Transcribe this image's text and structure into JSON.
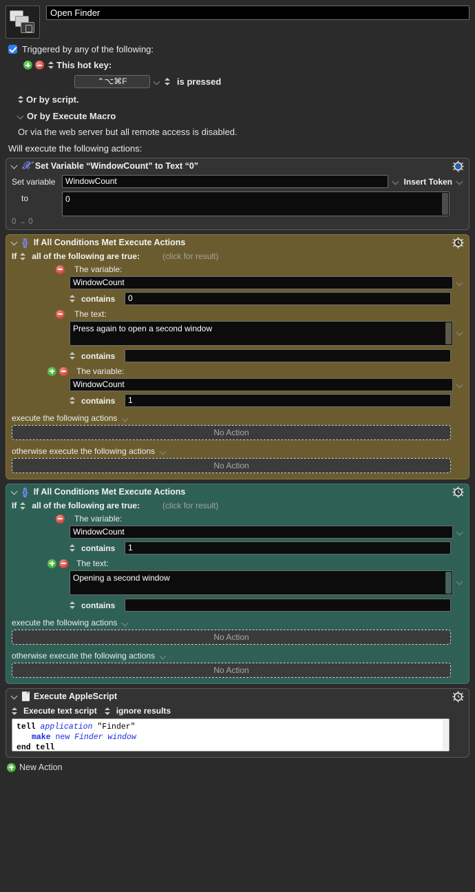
{
  "macro": {
    "icon_name": "stacked-windows-icon",
    "title": "Open Finder"
  },
  "trigger": {
    "checkbox_label": "Triggered by any of the following:",
    "hotkey_label": "This hot key:",
    "hotkey_value": "⌃⌥⌘F",
    "hotkey_condition": "is pressed",
    "or_by_script": "Or by script.",
    "or_by_execute_macro": "Or by Execute Macro",
    "web_server_note": "Or via the web server but all remote access is disabled.",
    "will_execute": "Will execute the following actions:"
  },
  "actions": [
    {
      "type": "set-variable",
      "title": "Set Variable “WindowCount” to Text “0”",
      "gear_icon": "gear-blue-icon",
      "set_variable_label": "Set variable",
      "variable_name": "WindowCount",
      "insert_token_label": "Insert Token",
      "to_label": "to",
      "to_value": "0",
      "result_line": "0 → 0",
      "color": "#333333"
    },
    {
      "type": "if-all-conditions",
      "title": "If All Conditions Met Execute Actions",
      "gear_icon": "gear-clock-icon",
      "color": "#6b5c2f",
      "if_label": "If",
      "condition_mode": "all of the following are true:",
      "click_for_result": "(click for result)",
      "conditions": [
        {
          "kind_label": "The variable:",
          "has_add": false,
          "value": "WindowCount",
          "operator": "contains",
          "operand": "0",
          "multiline": false
        },
        {
          "kind_label": "The text:",
          "has_add": false,
          "value": "Press again to open a second window",
          "operator": "contains",
          "operand": "",
          "multiline": true
        },
        {
          "kind_label": "The variable:",
          "has_add": true,
          "value": "WindowCount",
          "operator": "contains",
          "operand": "1",
          "multiline": false
        }
      ],
      "then_label": "execute the following actions",
      "then_placeholder": "No Action",
      "else_label": "otherwise execute the following actions",
      "else_placeholder": "No Action"
    },
    {
      "type": "if-all-conditions",
      "title": "If All Conditions Met Execute Actions",
      "gear_icon": "gear-clock-icon",
      "color": "#2f6055",
      "if_label": "If",
      "condition_mode": "all of the following are true:",
      "click_for_result": "(click for result)",
      "conditions": [
        {
          "kind_label": "The variable:",
          "has_add": false,
          "value": "WindowCount",
          "operator": "contains",
          "operand": "1",
          "multiline": false
        },
        {
          "kind_label": "The text:",
          "has_add": true,
          "value": "Opening a second window",
          "operator": "contains",
          "operand": "",
          "multiline": true
        }
      ],
      "then_label": "execute the following actions",
      "then_placeholder": "No Action",
      "else_label": "otherwise execute the following actions",
      "else_placeholder": "No Action"
    },
    {
      "type": "execute-applescript",
      "title": "Execute AppleScript",
      "gear_icon": "gear-clock-icon",
      "source_mode": "Execute text script",
      "results_mode": "ignore results",
      "script_lines": [
        {
          "indent": 0,
          "tokens": [
            {
              "t": "tell ",
              "c": "kw"
            },
            {
              "t": "application ",
              "c": "cls"
            },
            {
              "t": "\"Finder\"",
              "c": "str"
            }
          ]
        },
        {
          "indent": 1,
          "tokens": [
            {
              "t": "make ",
              "c": "blub"
            },
            {
              "t": "new ",
              "c": "blu"
            },
            {
              "t": "Finder window",
              "c": "cls"
            }
          ]
        },
        {
          "indent": 0,
          "tokens": [
            {
              "t": "end tell",
              "c": "kw"
            }
          ]
        }
      ],
      "color": "#333333"
    }
  ],
  "footer": {
    "new_action_label": "New Action"
  },
  "colors": {
    "accent_blue": "#2a7ef0",
    "olive": "#6b5c2f",
    "teal": "#2f6055",
    "panel": "#333333",
    "background": "#2b2b2b"
  }
}
